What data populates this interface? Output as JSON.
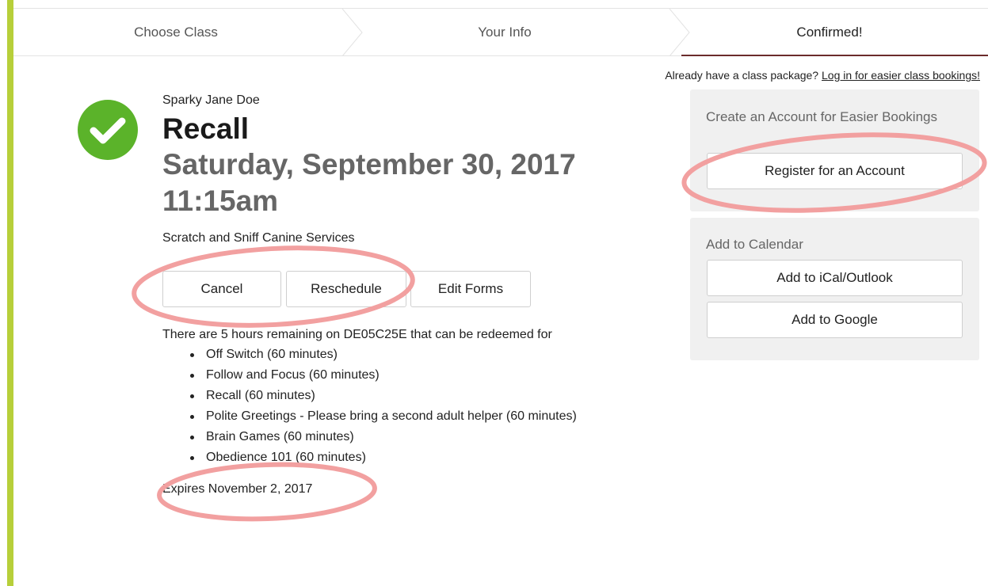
{
  "steps": {
    "items": [
      {
        "label": "Choose Class"
      },
      {
        "label": "Your Info"
      },
      {
        "label": "Confirmed!"
      }
    ]
  },
  "login": {
    "prompt": "Already have a class package?",
    "link_label": "Log in for easier class bookings!"
  },
  "booking": {
    "customer_name": "Sparky Jane Doe",
    "class_name": "Recall",
    "date": "Saturday, September 30, 2017",
    "time": "11:15am",
    "business": "Scratch and Sniff Canine Services",
    "status_icon": "check-circle-icon"
  },
  "actions": {
    "cancel_label": "Cancel",
    "reschedule_label": "Reschedule",
    "edit_forms_label": "Edit Forms"
  },
  "package": {
    "remaining_text": "There are 5 hours remaining on DE05C25E that can be redeemed for",
    "classes": [
      "Off Switch (60 minutes)",
      "Follow and Focus (60 minutes)",
      "Recall (60 minutes)",
      "Polite Greetings - Please bring a second adult helper (60 minutes)",
      "Brain Games (60 minutes)",
      "Obedience 101 (60 minutes)"
    ],
    "expires_text": "Expires November 2, 2017"
  },
  "sidebar": {
    "account_heading": "Create an Account for Easier Bookings",
    "register_label": "Register for an Account",
    "calendar_heading": "Add to Calendar",
    "ical_label": "Add to iCal/Outlook",
    "google_label": "Add to Google"
  },
  "colors": {
    "accent_bar": "#b7cf3a",
    "success_green": "#5bb32a",
    "active_step_underline": "#6b2b2b",
    "annotation_circle": "#f2a0a0"
  }
}
